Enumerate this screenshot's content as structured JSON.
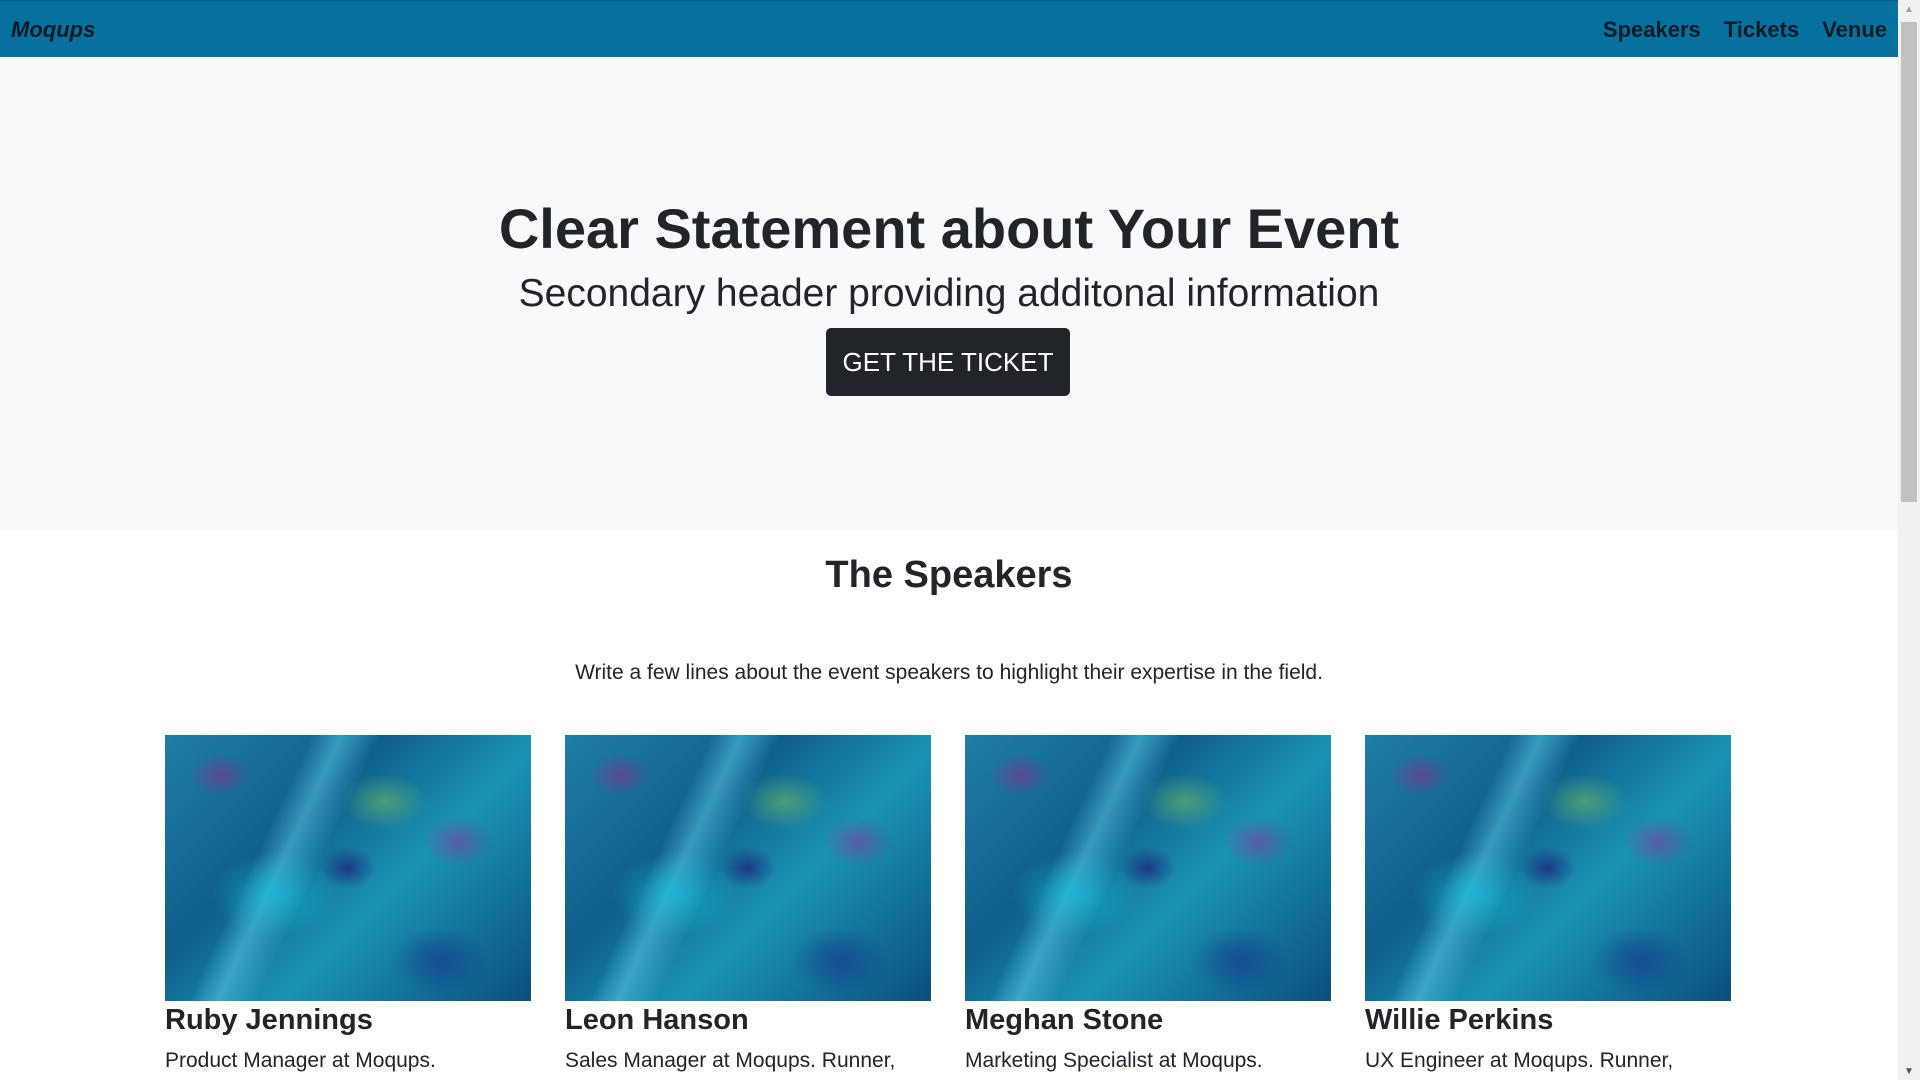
{
  "navbar": {
    "brand": "Moqups",
    "links": [
      "Speakers",
      "Tickets",
      "Venue"
    ],
    "background_color": "#06709e"
  },
  "hero": {
    "title": "Clear Statement about Your Event",
    "subtitle": "Secondary header providing additonal information",
    "cta_label": "GET THE TICKET",
    "background_color": "#f8f9fa"
  },
  "speakers": {
    "heading": "The Speakers",
    "intro": "Write a few lines about the event speakers to highlight their expertise in the field.",
    "items": [
      {
        "name": "Ruby Jennings",
        "bio": "Product Manager at Moqups."
      },
      {
        "name": "Leon Hanson",
        "bio": "Sales Manager at Moqups. Runner,"
      },
      {
        "name": "Meghan Stone",
        "bio": "Marketing Specialist at Moqups."
      },
      {
        "name": "Willie Perkins",
        "bio": "UX Engineer at Moqups. Runner,"
      }
    ]
  },
  "scrollbar": {
    "up_icon": "triangle-up",
    "down_icon": "triangle-down"
  },
  "colors": {
    "primary_dark": "#212529",
    "accent_blue": "#06709e"
  }
}
